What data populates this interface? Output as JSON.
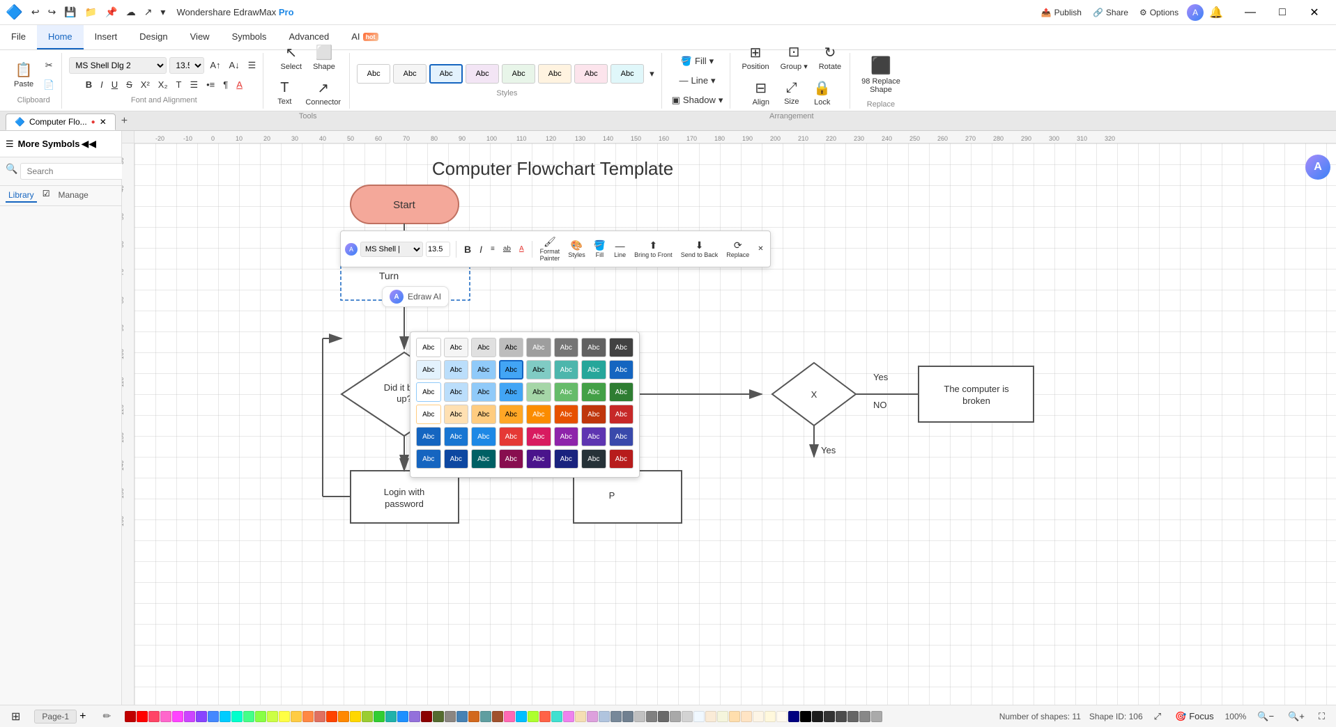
{
  "app": {
    "title": "Wondershare EdrawMax Pro",
    "logo": "🔷"
  },
  "titlebar": {
    "undo_icon": "↩",
    "redo_icon": "↪",
    "save_icon": "💾",
    "folder_icon": "📁",
    "minimize": "—",
    "maximize": "□",
    "close": "✕",
    "publish": "Publish",
    "share": "Share",
    "options": "Options"
  },
  "menu": {
    "items": [
      {
        "id": "file",
        "label": "File"
      },
      {
        "id": "home",
        "label": "Home",
        "active": true
      },
      {
        "id": "insert",
        "label": "Insert"
      },
      {
        "id": "design",
        "label": "Design"
      },
      {
        "id": "view",
        "label": "View"
      },
      {
        "id": "symbols",
        "label": "Symbols"
      },
      {
        "id": "advanced",
        "label": "Advanced"
      },
      {
        "id": "ai",
        "label": "AI",
        "badge": "hot"
      }
    ]
  },
  "toolbar": {
    "select_label": "Select",
    "shape_label": "Shape",
    "text_label": "Text",
    "connector_label": "Connector",
    "font_name": "MS Shell Dlg 2",
    "font_size": "13.5",
    "fill_label": "Fill",
    "line_label": "Line",
    "shadow_label": "Shadow",
    "position_label": "Position",
    "group_label": "Group",
    "rotate_label": "Rotate",
    "align_label": "Align",
    "size_label": "Size",
    "lock_label": "Lock",
    "replace_shape_label": "Replace Shape",
    "clipboard_label": "Clipboard",
    "font_alignment_label": "Font and Alignment",
    "tools_label": "Tools",
    "styles_label": "Styles",
    "arrangement_label": "Arrangement",
    "replace_label": "Replace"
  },
  "sidebar": {
    "title": "More Symbols",
    "search_placeholder": "Search",
    "search_btn": "Search",
    "library_tab": "Library",
    "manage_label": "Manage"
  },
  "canvas": {
    "title": "Computer Flowchart Template",
    "start_label": "Start",
    "did_it_boot_label": "Did it boot up?",
    "login_label": "Login with password",
    "computer_broken_label": "The computer is broken",
    "no1": "No",
    "yes1": "Yes",
    "yes2": "Yes",
    "no2": "NO",
    "turn_label": "Turn"
  },
  "floating_toolbar": {
    "font_name": "MS Shell |",
    "font_size": "13.5",
    "bold": "B",
    "italic": "I",
    "align_center": "≡",
    "underline": "U̲",
    "font_color": "A",
    "styles_label": "Styles",
    "fill_label": "Fill",
    "line_label": "Line",
    "bring_to_front_label": "Bring to Front",
    "send_to_back_label": "Send to Back",
    "replace_label": "Replace",
    "format_painter_label": "Format Painter"
  },
  "ctx_toolbar": {
    "format_painter": "Format\nPainter",
    "styles": "Styles",
    "fill": "Fill",
    "line": "Line",
    "bring_to_front": "Bring to Front",
    "send_to_back": "Send to Back",
    "replace": "Replace"
  },
  "style_swatches": {
    "rows": [
      [
        "#ffffff",
        "#f5f5f5",
        "#e0e0e0",
        "#bdbdbd",
        "#9e9e9e",
        "#757575",
        "#616161",
        "#424242"
      ],
      [
        "#e3f2fd",
        "#bbdefb",
        "#90caf9",
        "#42a5f5",
        "#1e88e5",
        "#1565c0",
        "#0d47a1",
        "#82b1ff"
      ],
      [
        "#f3e5f5",
        "#e1bee7",
        "#ce93d8",
        "#ab47bc",
        "#8e24aa",
        "#6a1b9a",
        "#4a148c",
        "#ea80fc"
      ],
      [
        "#e8f5e9",
        "#c8e6c9",
        "#a5d6a7",
        "#66bb6a",
        "#43a047",
        "#2e7d32",
        "#1b5e20",
        "#69f0ae"
      ],
      [
        "#fff3e0",
        "#ffe0b2",
        "#ffcc80",
        "#ffa726",
        "#fb8c00",
        "#e65100",
        "#bf360c",
        "#ffab40"
      ],
      [
        "#fce4ec",
        "#f8bbd0",
        "#f48fb1",
        "#ec407a",
        "#e91e63",
        "#c2185b",
        "#880e4f",
        "#ff80ab"
      ]
    ],
    "toolbar_swatches": [
      "#ffffff",
      "#f5f5f5",
      "#bbdefb",
      "#1e88e5",
      "#42a5f5",
      "#ce93d8",
      "#8e24aa",
      "#a5d6a7",
      "#43a047"
    ]
  },
  "status_bar": {
    "page_label": "Page-1",
    "add_page": "+",
    "shapes_count": "Number of shapes: 11",
    "shape_id": "Shape ID: 106",
    "zoom": "100%",
    "focus": "Focus"
  },
  "colors": {
    "palette": [
      "#c00000",
      "#ff0000",
      "#ff6699",
      "#ff66cc",
      "#ff66ff",
      "#cc66ff",
      "#9966ff",
      "#6699ff",
      "#66ffff",
      "#66ffcc",
      "#66ff99",
      "#99ff66",
      "#ccff66",
      "#ffff66",
      "#ffcc66",
      "#ff9966",
      "#e07060",
      "#ff4500",
      "#ff8c00",
      "#ffd700",
      "#9acd32",
      "#32cd32",
      "#00ced1",
      "#1e90ff",
      "#9370db",
      "#8b008b"
    ]
  },
  "edraw_ai": {
    "label": "Edraw AI"
  }
}
